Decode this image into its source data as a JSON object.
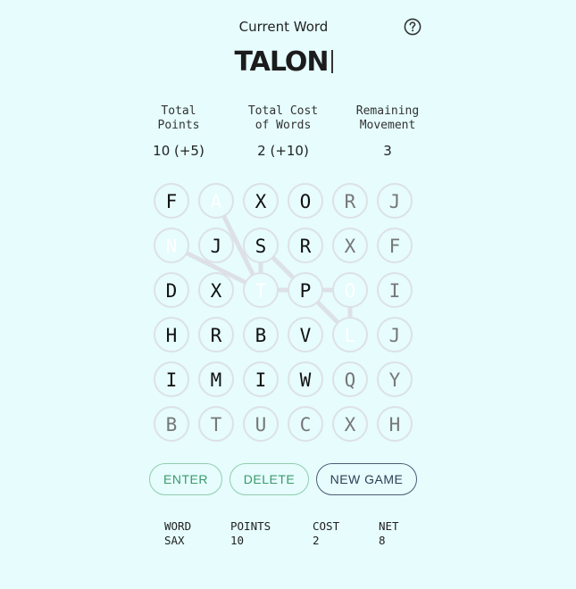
{
  "header": {
    "title": "Current Word",
    "current_word": "TALON",
    "help_icon": "question-circle-icon"
  },
  "stats": [
    {
      "label": "Total\nPoints",
      "value": "10 (+5)"
    },
    {
      "label": "Total Cost\nof Words",
      "value": "2 (+10)"
    },
    {
      "label": "Remaining\nMovement",
      "value": "3"
    }
  ],
  "colors": {
    "background": "#e6fcfd",
    "selected": "#ffa20a",
    "current": "#0b7a0b",
    "cell_border": "#dde1e6",
    "path": "#dde1e6",
    "dim_text": "#777777"
  },
  "grid": [
    [
      "F",
      "A",
      "X",
      "O",
      "R",
      "J"
    ],
    [
      "N",
      "J",
      "S",
      "R",
      "X",
      "F"
    ],
    [
      "D",
      "X",
      "T",
      "P",
      "O",
      "I"
    ],
    [
      "H",
      "R",
      "B",
      "V",
      "L",
      "J"
    ],
    [
      "I",
      "M",
      "I",
      "W",
      "Q",
      "Y"
    ],
    [
      "B",
      "T",
      "U",
      "C",
      "X",
      "H"
    ]
  ],
  "cell_states": [
    [
      "",
      "selected",
      "",
      "",
      "dim",
      "dim"
    ],
    [
      "current",
      "",
      "",
      "",
      "dim",
      "dim"
    ],
    [
      "",
      "",
      "selected",
      "",
      "selected",
      "dim"
    ],
    [
      "",
      "",
      "",
      "",
      "selected",
      "dim"
    ],
    [
      "",
      "",
      "",
      "",
      "dim",
      "dim"
    ],
    [
      "dim",
      "dim",
      "dim",
      "dim",
      "dim",
      "dim"
    ]
  ],
  "path": [
    [
      [
        1,
        0
      ],
      [
        2,
        2
      ]
    ],
    [
      [
        0,
        1
      ],
      [
        2,
        2
      ]
    ],
    [
      [
        1,
        2
      ],
      [
        2,
        2
      ]
    ],
    [
      [
        2,
        2
      ],
      [
        2,
        4
      ]
    ],
    [
      [
        1,
        2
      ],
      [
        3,
        4
      ]
    ],
    [
      [
        2,
        4
      ],
      [
        3,
        4
      ]
    ]
  ],
  "buttons": {
    "enter": "ENTER",
    "delete": "DELETE",
    "new_game": "NEW GAME"
  },
  "history": {
    "headers": [
      "WORD",
      "POINTS",
      "COST",
      "NET"
    ],
    "rows": [
      [
        "SAX",
        "10",
        "2",
        "8"
      ]
    ]
  }
}
